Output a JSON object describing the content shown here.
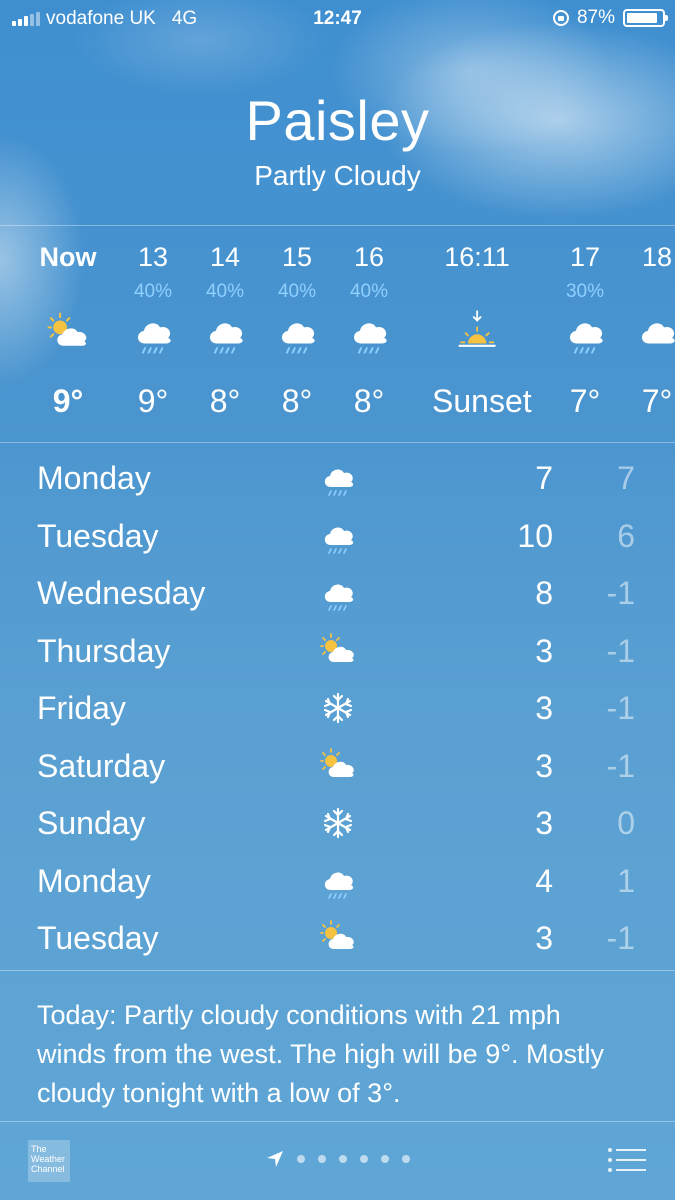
{
  "status_bar": {
    "carrier": "vodafone UK",
    "network": "4G",
    "time": "12:47",
    "battery": "87%",
    "battery_level": 0.87
  },
  "location": {
    "city": "Paisley",
    "condition": "Partly Cloudy"
  },
  "hourly": [
    {
      "label": "Now",
      "pop": "",
      "icon": "partly-cloudy-icon",
      "temp": "9°"
    },
    {
      "label": "13",
      "pop": "40%",
      "icon": "rain-icon",
      "temp": "9°"
    },
    {
      "label": "14",
      "pop": "40%",
      "icon": "rain-icon",
      "temp": "8°"
    },
    {
      "label": "15",
      "pop": "40%",
      "icon": "rain-icon",
      "temp": "8°"
    },
    {
      "label": "16",
      "pop": "40%",
      "icon": "rain-icon",
      "temp": "8°"
    },
    {
      "label": "16:11",
      "pop": "",
      "icon": "sunset-icon",
      "temp": "Sunset"
    },
    {
      "label": "17",
      "pop": "30%",
      "icon": "rain-icon",
      "temp": "7°"
    },
    {
      "label": "18",
      "pop": "",
      "icon": "cloud-icon",
      "temp": "7°"
    }
  ],
  "daily": [
    {
      "day": "Monday",
      "icon": "rain-icon",
      "high": "7",
      "low": "7"
    },
    {
      "day": "Tuesday",
      "icon": "rain-icon",
      "high": "10",
      "low": "6"
    },
    {
      "day": "Wednesday",
      "icon": "rain-icon",
      "high": "8",
      "low": "-1"
    },
    {
      "day": "Thursday",
      "icon": "partly-cloudy-icon",
      "high": "3",
      "low": "-1"
    },
    {
      "day": "Friday",
      "icon": "snow-icon",
      "high": "3",
      "low": "-1"
    },
    {
      "day": "Saturday",
      "icon": "partly-cloudy-icon",
      "high": "3",
      "low": "-1"
    },
    {
      "day": "Sunday",
      "icon": "snow-icon",
      "high": "3",
      "low": "0"
    },
    {
      "day": "Monday",
      "icon": "rain-icon",
      "high": "4",
      "low": "1"
    },
    {
      "day": "Tuesday",
      "icon": "partly-cloudy-icon",
      "high": "3",
      "low": "-1"
    }
  ],
  "summary": "Today: Partly cloudy conditions with 21 mph winds from the west. The high will be 9°. Mostly cloudy tonight with a low of 3°.",
  "footer": {
    "provider": "The Weather Channel"
  },
  "colors": {
    "precip": "#8fd0ff",
    "sun": "#f5c242"
  }
}
